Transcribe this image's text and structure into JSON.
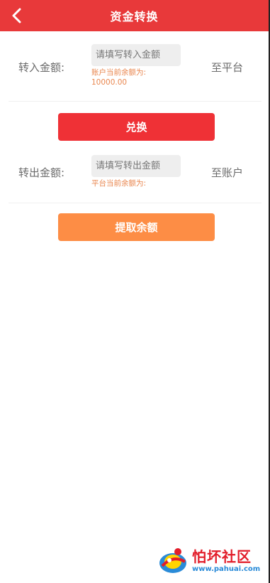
{
  "header": {
    "title": "资金转换",
    "back_icon": "chevron-left-icon"
  },
  "transfer_in": {
    "label": "转入金额:",
    "placeholder": "请填写转入金额",
    "value": "",
    "hint_line1": "账户当前余额为:",
    "hint_line2": "10000.00",
    "destination": "至平台"
  },
  "exchange_button": {
    "label": "兑换"
  },
  "transfer_out": {
    "label": "转出金额:",
    "placeholder": "请填写转出金额",
    "value": "",
    "hint": "平台当前余额为:",
    "destination": "至账户"
  },
  "withdraw_button": {
    "label": "提取余额"
  },
  "watermark": {
    "title": "怕坏社区",
    "url": "www.pahuai.com"
  },
  "colors": {
    "header_bg": "#e8393a",
    "primary_button": "#ef3136",
    "secondary_button": "#fd8d45",
    "hint_text": "#e9864e"
  }
}
